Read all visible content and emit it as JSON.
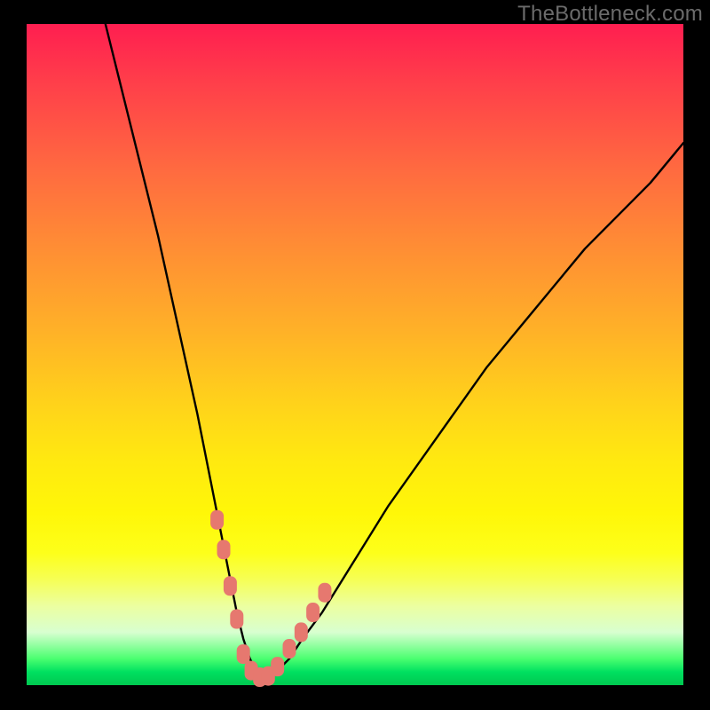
{
  "watermark": "TheBottleneck.com",
  "chart_data": {
    "type": "line",
    "title": "",
    "xlabel": "",
    "ylabel": "",
    "xlim": [
      0,
      100
    ],
    "ylim": [
      0,
      100
    ],
    "grid": false,
    "series": [
      {
        "name": "bottleneck-curve",
        "x": [
          12,
          14,
          16,
          18,
          20,
          22,
          24,
          26,
          28,
          29,
          30,
          31,
          32,
          33,
          34,
          35,
          36,
          37,
          38,
          40,
          42,
          45,
          50,
          55,
          60,
          65,
          70,
          75,
          80,
          85,
          90,
          95,
          100
        ],
        "values": [
          100,
          92,
          84,
          76,
          68,
          59,
          50,
          41,
          31,
          26,
          21,
          16,
          11,
          7,
          4,
          2,
          1,
          1,
          2,
          4,
          7,
          11,
          19,
          27,
          34,
          41,
          48,
          54,
          60,
          66,
          71,
          76,
          82
        ]
      }
    ],
    "markers": [
      {
        "name": "left-marker-1",
        "x": 29.0,
        "y": 25.0
      },
      {
        "name": "left-marker-2",
        "x": 30.0,
        "y": 20.5
      },
      {
        "name": "left-marker-3",
        "x": 31.0,
        "y": 15.0
      },
      {
        "name": "left-marker-4",
        "x": 32.0,
        "y": 10.0
      },
      {
        "name": "bottom-1",
        "x": 33.0,
        "y": 4.7
      },
      {
        "name": "bottom-2",
        "x": 34.2,
        "y": 2.2
      },
      {
        "name": "bottom-3",
        "x": 35.5,
        "y": 1.2
      },
      {
        "name": "bottom-4",
        "x": 36.8,
        "y": 1.4
      },
      {
        "name": "bottom-5",
        "x": 38.2,
        "y": 2.8
      },
      {
        "name": "right-marker-1",
        "x": 40.0,
        "y": 5.5
      },
      {
        "name": "right-marker-2",
        "x": 41.8,
        "y": 8.0
      },
      {
        "name": "right-marker-3",
        "x": 43.6,
        "y": 11.0
      },
      {
        "name": "right-marker-4",
        "x": 45.4,
        "y": 14.0
      }
    ],
    "marker_color": "#e6786f",
    "curve_color": "#000000"
  }
}
